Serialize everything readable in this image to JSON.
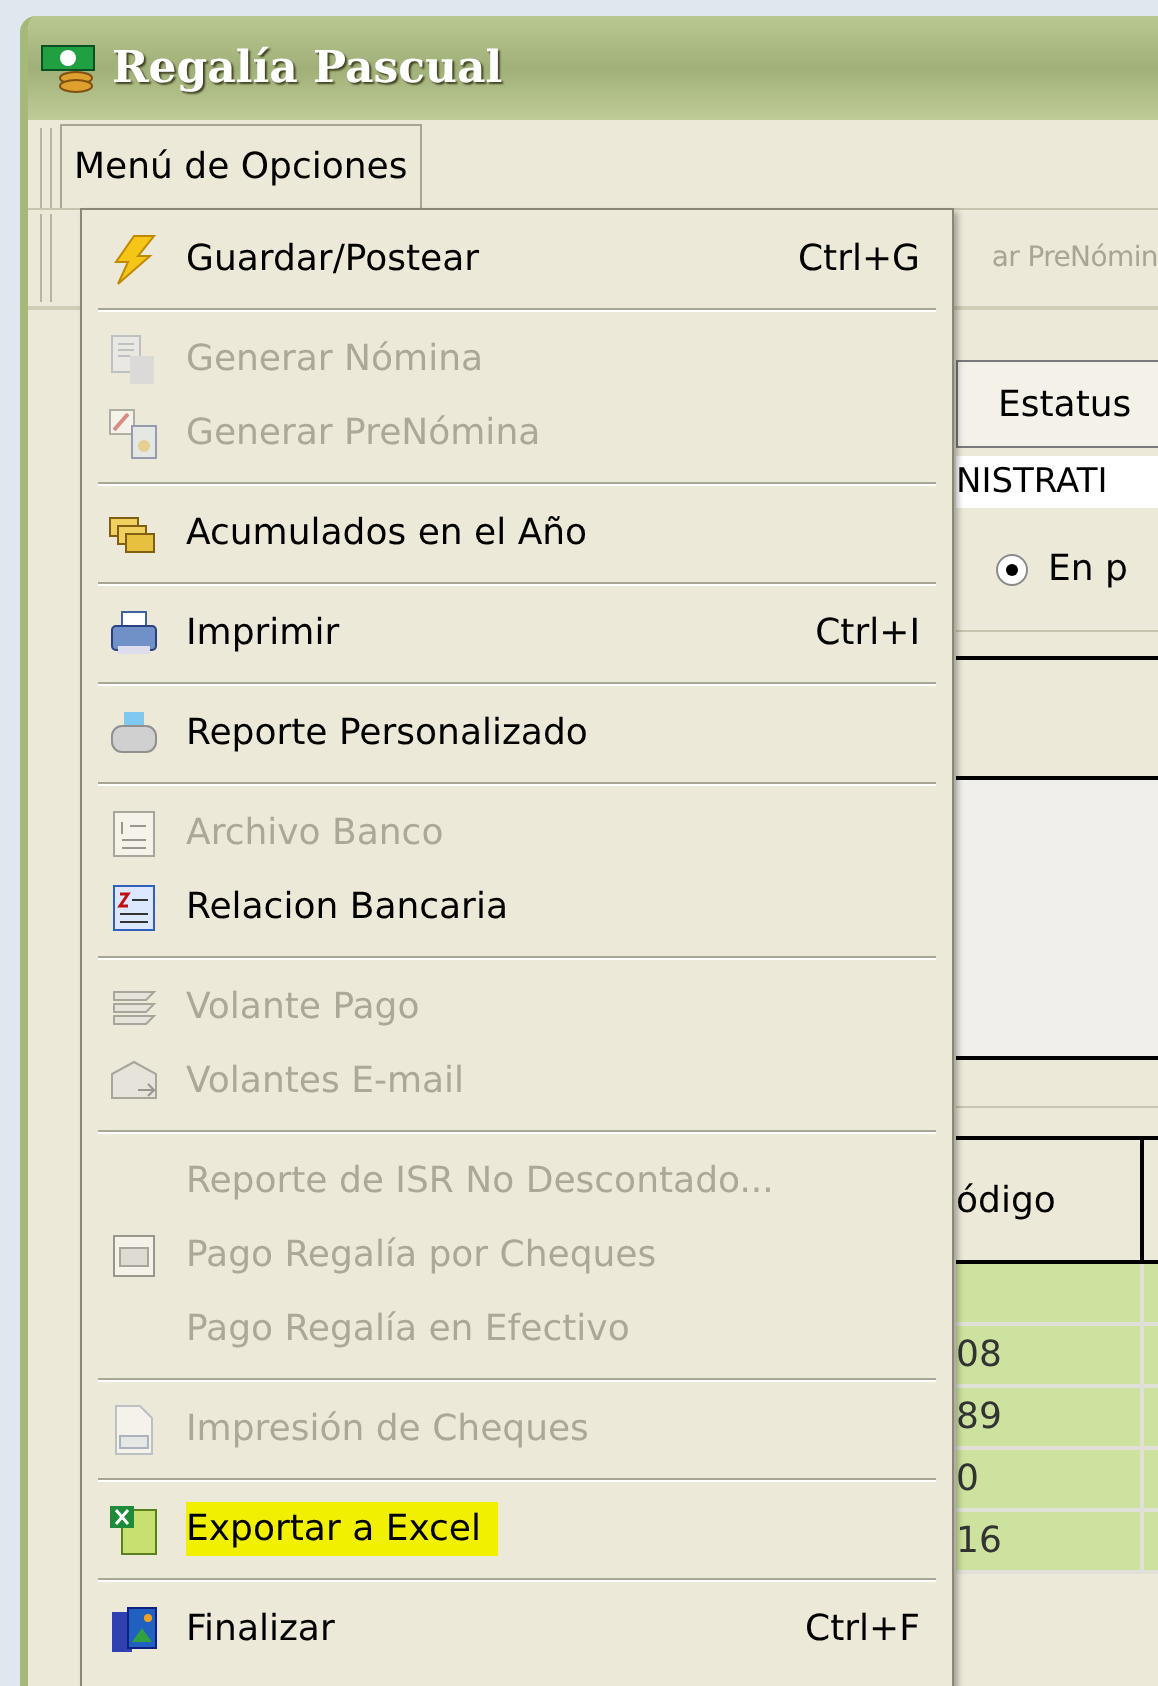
{
  "window": {
    "title": "Regalía Pascual"
  },
  "menubar": [
    {
      "label": "Menú de Opciones",
      "selected": true
    }
  ],
  "toolbar": {
    "partial_button": "ar PreNómin"
  },
  "form": {
    "status_button": "Estatus",
    "field_value": "NISTRATI",
    "radio": {
      "label": "En p",
      "selected": true
    }
  },
  "table": {
    "columns": [
      "ódigo"
    ],
    "rows": [
      {
        "cell": ""
      },
      {
        "cell": "08"
      },
      {
        "cell": "89"
      },
      {
        "cell": "0"
      },
      {
        "cell": "16"
      }
    ]
  },
  "menu": [
    {
      "kind": "item",
      "label": "Guardar/Postear",
      "shortcut": "Ctrl+G",
      "disabled": false,
      "highlighted": false
    },
    {
      "kind": "separator"
    },
    {
      "kind": "item",
      "label": "Generar Nómina",
      "disabled": true,
      "highlighted": false
    },
    {
      "kind": "item",
      "label": "Generar PreNómina",
      "disabled": true,
      "highlighted": false
    },
    {
      "kind": "separator"
    },
    {
      "kind": "item",
      "label": "Acumulados en el Año",
      "disabled": false,
      "highlighted": false
    },
    {
      "kind": "separator"
    },
    {
      "kind": "item",
      "label": "Imprimir",
      "shortcut": "Ctrl+I",
      "disabled": false,
      "highlighted": false
    },
    {
      "kind": "separator"
    },
    {
      "kind": "item",
      "label": "Reporte Personalizado",
      "disabled": false,
      "highlighted": false
    },
    {
      "kind": "separator"
    },
    {
      "kind": "item",
      "label": "Archivo Banco",
      "disabled": true,
      "highlighted": false
    },
    {
      "kind": "item",
      "label": "Relacion Bancaria",
      "disabled": false,
      "highlighted": false
    },
    {
      "kind": "separator"
    },
    {
      "kind": "item",
      "label": "Volante Pago",
      "disabled": true,
      "highlighted": false
    },
    {
      "kind": "item",
      "label": "Volantes E-mail",
      "disabled": true,
      "highlighted": false
    },
    {
      "kind": "separator"
    },
    {
      "kind": "item",
      "label": "Reporte de ISR No Descontado...",
      "disabled": true,
      "highlighted": false
    },
    {
      "kind": "item",
      "label": "Pago Regalía por Cheques",
      "disabled": true,
      "highlighted": false
    },
    {
      "kind": "item",
      "label": "Pago Regalía en Efectivo",
      "disabled": true,
      "highlighted": false
    },
    {
      "kind": "separator"
    },
    {
      "kind": "item",
      "label": "Impresión de Cheques",
      "disabled": true,
      "highlighted": false
    },
    {
      "kind": "separator"
    },
    {
      "kind": "item",
      "label": "Exportar a Excel",
      "disabled": false,
      "highlighted": true
    },
    {
      "kind": "separator"
    },
    {
      "kind": "item",
      "label": "Finalizar",
      "shortcut": "Ctrl+F",
      "disabled": false,
      "highlighted": false
    }
  ]
}
